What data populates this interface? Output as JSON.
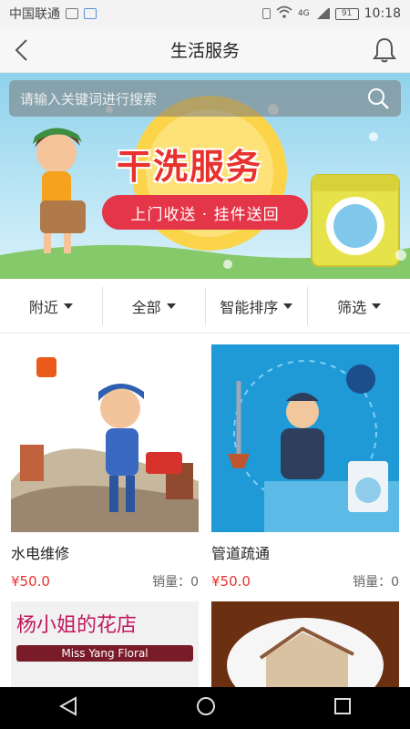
{
  "statusbar": {
    "carrier": "中国联通",
    "network": "4G",
    "battery": "91",
    "time": "10:18"
  },
  "nav": {
    "title": "生活服务"
  },
  "banner": {
    "search_placeholder": "请输入关键词进行搜索",
    "title": "干洗服务",
    "subtitle": "上门收送 · 挂件送回"
  },
  "filters": [
    {
      "label": "附近"
    },
    {
      "label": "全部"
    },
    {
      "label": "智能排序"
    },
    {
      "label": "筛选"
    }
  ],
  "items": [
    {
      "name": "水电维修",
      "badge": "水电维修",
      "price": "¥50.0",
      "sales": "销量：0"
    },
    {
      "name": "管道疏通",
      "badge": "管道疏通",
      "price": "¥50.0",
      "sales": "销量：0"
    },
    {
      "name": "",
      "sign_cn": "杨小姐的花店",
      "sign_en": "Miss Yang Floral",
      "price": "",
      "sales": ""
    },
    {
      "name": "",
      "price": "",
      "sales": ""
    }
  ],
  "colors": {
    "accent": "#e8322e",
    "banner_sky": "#8fd2ec",
    "tile_blue": "#1f9ad6"
  }
}
